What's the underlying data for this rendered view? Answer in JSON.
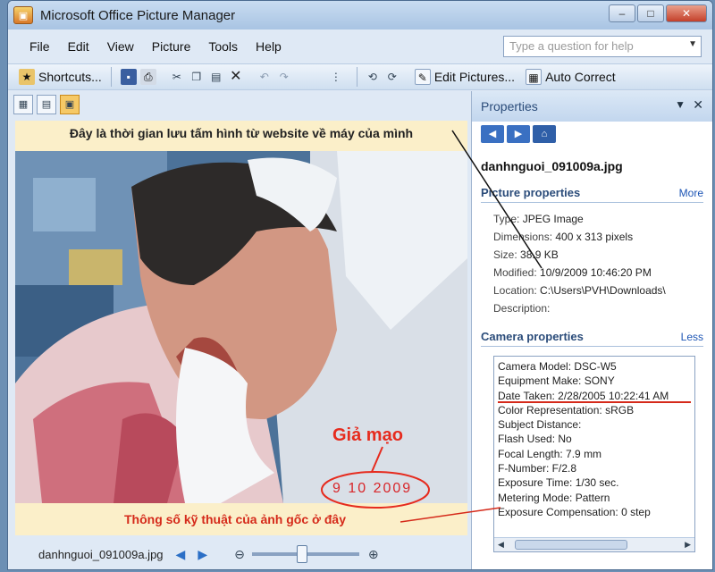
{
  "window": {
    "title": "Microsoft Office Picture Manager",
    "app_icon": "picture-manager-icon",
    "controls": {
      "minimize": "–",
      "maximize": "□",
      "close": "✕"
    }
  },
  "menu": [
    "File",
    "Edit",
    "View",
    "Picture",
    "Tools",
    "Help"
  ],
  "help_search": {
    "placeholder": "Type a question for help"
  },
  "toolbar": {
    "shortcuts_label": "Shortcuts...",
    "edit_pictures_label": "Edit Pictures...",
    "auto_correct_label": "Auto Correct"
  },
  "annotations": {
    "top": "Đây là thời gian lưu tấm hình từ website về máy của mình",
    "fake": "Giả mạo",
    "bottom": "Thông số kỹ thuật của ảnh gốc ở đây"
  },
  "photo": {
    "date_stamp": "9 10 2009"
  },
  "status": {
    "filename": "danhnguoi_091009a.jpg"
  },
  "properties": {
    "title": "Properties",
    "filename": "danhnguoi_091009a.jpg",
    "picture_section": {
      "title": "Picture properties",
      "link": "More"
    },
    "picture_props": [
      {
        "label": "Type:",
        "value": "JPEG Image"
      },
      {
        "label": "Dimensions:",
        "value": "400 x 313 pixels"
      },
      {
        "label": "Size:",
        "value": "38.9 KB"
      },
      {
        "label": "Modified:",
        "value": "10/9/2009 10:46:20 PM"
      },
      {
        "label": "Location:",
        "value": "C:\\Users\\PVH\\Downloads\\"
      },
      {
        "label": "Description:",
        "value": ""
      }
    ],
    "camera_section": {
      "title": "Camera properties",
      "link": "Less"
    },
    "camera_props": [
      "Camera Model: DSC-W5",
      "Equipment Make: SONY",
      "Date Taken: 2/28/2005 10:22:41 AM",
      "Color Representation: sRGB",
      "Subject Distance:",
      "Flash Used: No",
      "Focal Length: 7.9 mm",
      "F-Number: F/2.8",
      "Exposure Time: 1/30 sec.",
      "Metering Mode: Pattern",
      "Exposure Compensation: 0 step"
    ]
  },
  "colors": {
    "annotation_red": "#d52a1a",
    "annotation_bg": "#fbefc9",
    "panel_blue": "#2b4c7a"
  }
}
